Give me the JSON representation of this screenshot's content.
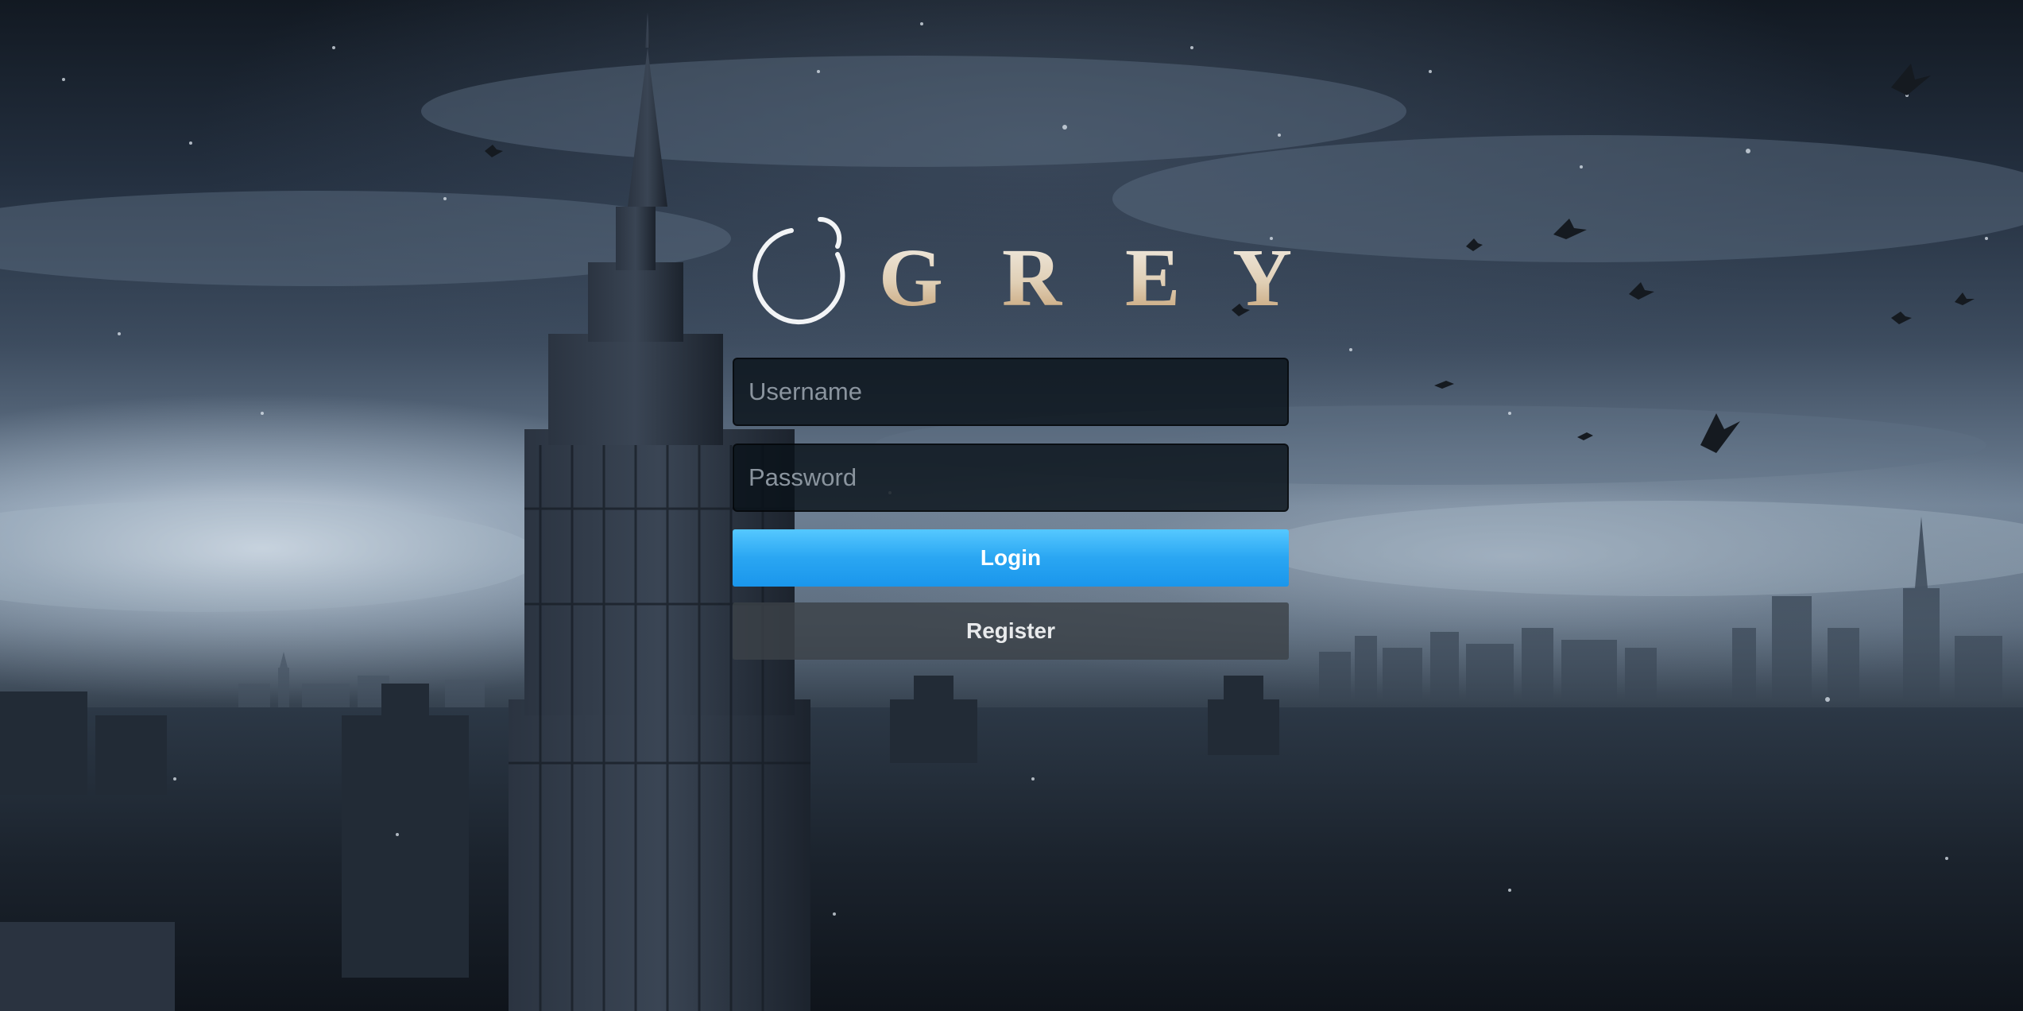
{
  "brand": {
    "logo_text": "GREY",
    "letters": [
      "G",
      "R",
      "E",
      "Y"
    ],
    "accent": "#c9a67a"
  },
  "form": {
    "username_placeholder": "Username",
    "password_placeholder": "Password",
    "login_label": "Login",
    "register_label": "Register"
  },
  "colors": {
    "login_button": "#2aa6f2",
    "register_button": "#3c4248",
    "field_bg": "#0a121a"
  }
}
